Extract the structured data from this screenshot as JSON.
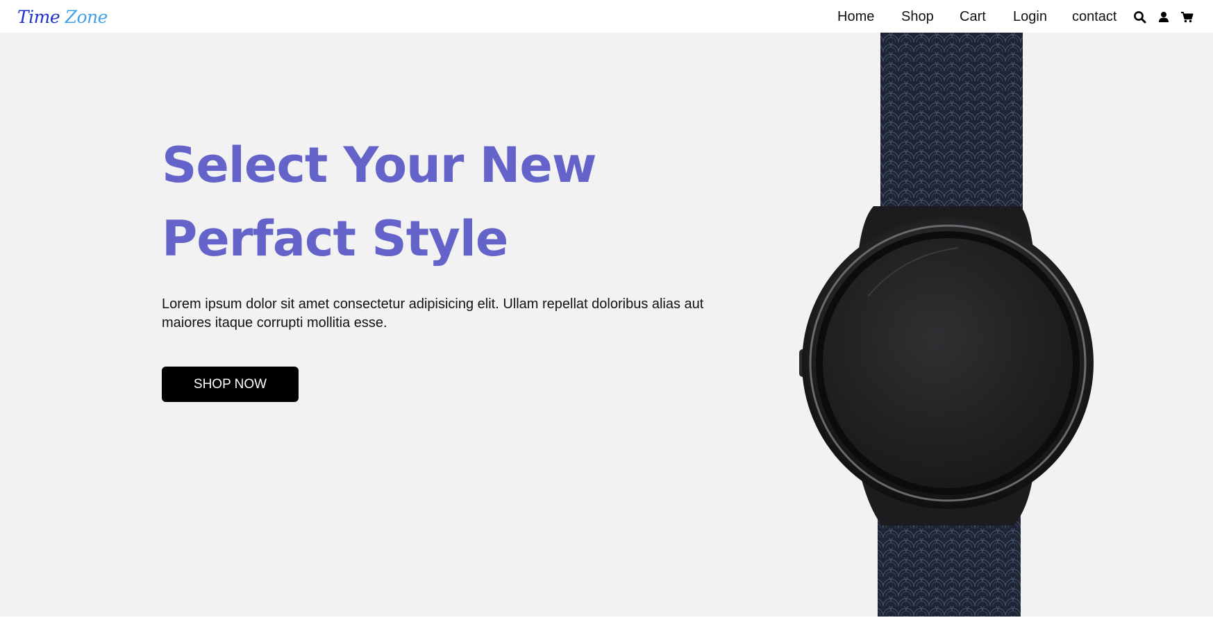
{
  "brand": {
    "part1": "Time",
    "part2": "Zone"
  },
  "nav": {
    "items": [
      "Home",
      "Shop",
      "Cart",
      "Login",
      "contact"
    ],
    "icons": [
      "search-icon",
      "user-icon",
      "cart-icon"
    ]
  },
  "hero": {
    "headline_line1": "Select Your New",
    "headline_line2": "Perfact Style",
    "description": "Lorem ipsum dolor sit amet consectetur adipisicing elit. Ullam repellat doloribus alias aut maiores itaque corrupti mollitia esse.",
    "button_label": "SHOP NOW"
  },
  "colors": {
    "accent": "#6363c9",
    "logo_dark": "#1c2fc9",
    "logo_light": "#3ea0e6",
    "hero_bg": "#f2f2f2",
    "button_bg": "#000000"
  }
}
